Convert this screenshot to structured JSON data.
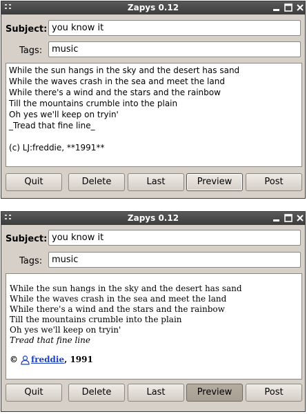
{
  "window1": {
    "title": "Zapys 0.12",
    "subject_label": "Subject:",
    "subject_value": "you know it",
    "tags_label": "Tags:",
    "tags_value": "music",
    "body_lines": [
      "While the sun hangs in the sky and the desert has sand",
      "While the waves crash in the sea and meet the land",
      "While there's a wind and the stars and the rainbow",
      "Till the mountains crumble into the plain",
      "Oh yes we'll keep on tryin'",
      "_Tread that fine line_",
      "",
      "(c) LJ:freddie, **1991**"
    ],
    "buttons": [
      "Quit",
      "Delete",
      "Last",
      "Preview",
      "Post"
    ]
  },
  "window2": {
    "title": "Zapys 0.12",
    "subject_label": "Subject:",
    "subject_value": "you know it",
    "tags_label": "Tags:",
    "tags_value": "music",
    "preview_lines": [
      "While the sun hangs in the sky and the desert has sand",
      "While the waves crash in the sea and meet the land",
      "While there's a wind and the stars and the rainbow",
      "Till the mountains crumble into the plain",
      "Oh yes we'll keep on tryin'"
    ],
    "preview_italic": "Tread that fine line",
    "signature": {
      "copyright": "©",
      "user": "freddie",
      "year": ", 1991"
    },
    "buttons": [
      "Quit",
      "Delete",
      "Last",
      "Preview",
      "Post"
    ]
  },
  "icons": {
    "window_menu": "window-menu-icon",
    "minimize": "minimize-icon",
    "maximize": "maximize-icon",
    "close": "close-icon",
    "user": "user-icon"
  },
  "colors": {
    "window_bg": "#d6d0c8",
    "titlebar": "#474747",
    "link": "#1a3fbf",
    "pressed_button": "#ada397"
  }
}
